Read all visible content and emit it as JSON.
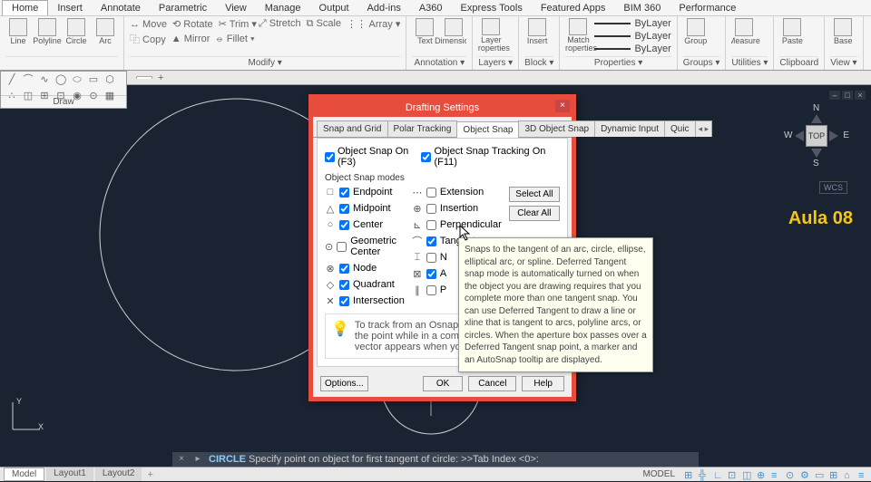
{
  "menubar": [
    "Home",
    "Insert",
    "Annotate",
    "Parametric",
    "View",
    "Manage",
    "Output",
    "Add-ins",
    "A360",
    "Express Tools",
    "Featured Apps",
    "BIM 360",
    "Performance"
  ],
  "menubar_active": 0,
  "ribbon": {
    "groups": [
      {
        "label": "",
        "items": [
          {
            "t": "Line"
          },
          {
            "t": "Polyline"
          },
          {
            "t": "Circle"
          },
          {
            "t": "Arc"
          }
        ]
      },
      {
        "label": "Modify ▾",
        "rows": [
          [
            "↔ Move",
            "⟲ Rotate",
            "✂ Trim ▾"
          ],
          [
            "⿻ Copy",
            "▲ Mirror",
            "⦵ Fillet ▾"
          ],
          [
            "⤢ Stretch",
            "⧉ Scale",
            "⋮⋮ Array ▾"
          ]
        ]
      },
      {
        "label": "Annotation ▾",
        "items": [
          {
            "t": "Text"
          },
          {
            "t": "Dimension"
          }
        ]
      },
      {
        "label": "Layers ▾",
        "items": [
          {
            "t": "Layer Properties"
          }
        ]
      },
      {
        "label": "Block ▾",
        "items": [
          {
            "t": "Insert"
          }
        ]
      },
      {
        "label": "Properties ▾",
        "items": [
          {
            "t": "Match Properties"
          }
        ],
        "bylayer": [
          "ByLayer",
          "ByLayer",
          "ByLayer"
        ]
      },
      {
        "label": "Groups ▾",
        "items": [
          {
            "t": "Group"
          }
        ]
      },
      {
        "label": "Utilities ▾",
        "items": [
          {
            "t": "Measure"
          }
        ]
      },
      {
        "label": "Clipboard",
        "items": [
          {
            "t": "Paste"
          }
        ]
      },
      {
        "label": "View ▾",
        "items": [
          {
            "t": "Base"
          }
        ]
      }
    ]
  },
  "doctab": {
    "name": "",
    "plus": "+"
  },
  "drawpanel": {
    "label": "Draw"
  },
  "compass": {
    "top": "TOP",
    "n": "N",
    "s": "S",
    "e": "E",
    "w": "W"
  },
  "wcs": "WCS",
  "aula": "Aula 08",
  "ucs": {
    "x": "X",
    "y": "Y"
  },
  "dialog": {
    "title": "Drafting Settings",
    "tabs": [
      "Snap and Grid",
      "Polar Tracking",
      "Object Snap",
      "3D Object Snap",
      "Dynamic Input",
      "Quic"
    ],
    "active_tab": 2,
    "osnap_on": {
      "label": "Object Snap On (F3)",
      "checked": true
    },
    "osnap_track": {
      "label": "Object Snap Tracking On (F11)",
      "checked": true
    },
    "section": "Object Snap modes",
    "left": [
      {
        "icon": "□",
        "label": "Endpoint",
        "checked": true
      },
      {
        "icon": "△",
        "label": "Midpoint",
        "checked": true
      },
      {
        "icon": "○",
        "label": "Center",
        "checked": true
      },
      {
        "icon": "⊙",
        "label": "Geometric Center",
        "checked": false
      },
      {
        "icon": "⊗",
        "label": "Node",
        "checked": true
      },
      {
        "icon": "◇",
        "label": "Quadrant",
        "checked": true
      },
      {
        "icon": "✕",
        "label": "Intersection",
        "checked": true
      }
    ],
    "right": [
      {
        "icon": "⋯",
        "label": "Extension",
        "checked": false
      },
      {
        "icon": "⊕",
        "label": "Insertion",
        "checked": false
      },
      {
        "icon": "⊾",
        "label": "Perpendicular",
        "checked": false
      },
      {
        "icon": "⌒",
        "label": "Tangent",
        "checked": true
      },
      {
        "icon": "⌶",
        "label": "N",
        "checked": false
      },
      {
        "icon": "⊠",
        "label": "A",
        "checked": true
      },
      {
        "icon": "∥",
        "label": "P",
        "checked": false
      }
    ],
    "select_all": "Select All",
    "clear_all": "Clear All",
    "tip": "To track from an Osnap point, pause over the point while in a command. A tracking vector appears when you move the cursor. To stop tracking, pause over the point again.",
    "options": "Options...",
    "ok": "OK",
    "cancel": "Cancel",
    "help": "Help"
  },
  "tooltip": "Snaps to the tangent of an arc, circle, ellipse, elliptical arc, or spline. Deferred Tangent snap mode is automatically turned on when the object you are drawing requires that you complete more than one tangent snap. You can use Deferred Tangent to draw a line or xline that is tangent to arcs, polyline arcs, or circles. When the aperture box passes over a Deferred Tangent snap point, a marker and an AutoSnap tooltip are displayed.",
  "cmdline": {
    "prefix": "CIRCLE",
    "text": " Specify point on object for first tangent of circle: >>Tab Index <0>:"
  },
  "status": {
    "layouts": [
      "Model",
      "Layout1",
      "Layout2"
    ],
    "active_layout": 0,
    "model": "MODEL"
  }
}
